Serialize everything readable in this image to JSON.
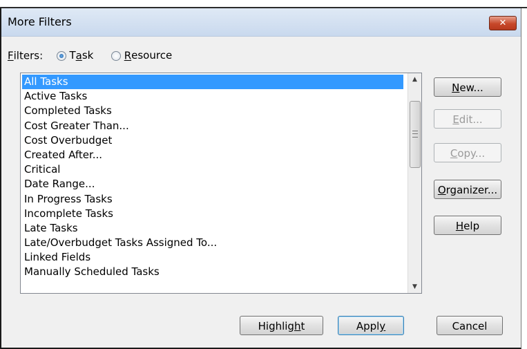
{
  "window": {
    "title": "More Filters",
    "close_icon": "close-icon"
  },
  "filters": {
    "label": "Filters:",
    "options": [
      {
        "label": "Task",
        "selected": true
      },
      {
        "label": "Resource",
        "selected": false
      }
    ]
  },
  "list": {
    "items": [
      "All Tasks",
      "Active Tasks",
      "Completed Tasks",
      "Cost Greater Than...",
      "Cost Overbudget",
      "Created After...",
      "Critical",
      "Date Range...",
      "In Progress Tasks",
      "Incomplete Tasks",
      "Late Tasks",
      "Late/Overbudget Tasks Assigned To...",
      "Linked Fields",
      "Manually Scheduled Tasks"
    ],
    "selected_index": 0
  },
  "side_buttons": {
    "new": "New...",
    "edit": "Edit...",
    "copy": "Copy...",
    "organizer": "Organizer...",
    "help": "Help"
  },
  "bottom_buttons": {
    "highlight": "Highlight",
    "apply": "Apply",
    "cancel": "Cancel"
  }
}
